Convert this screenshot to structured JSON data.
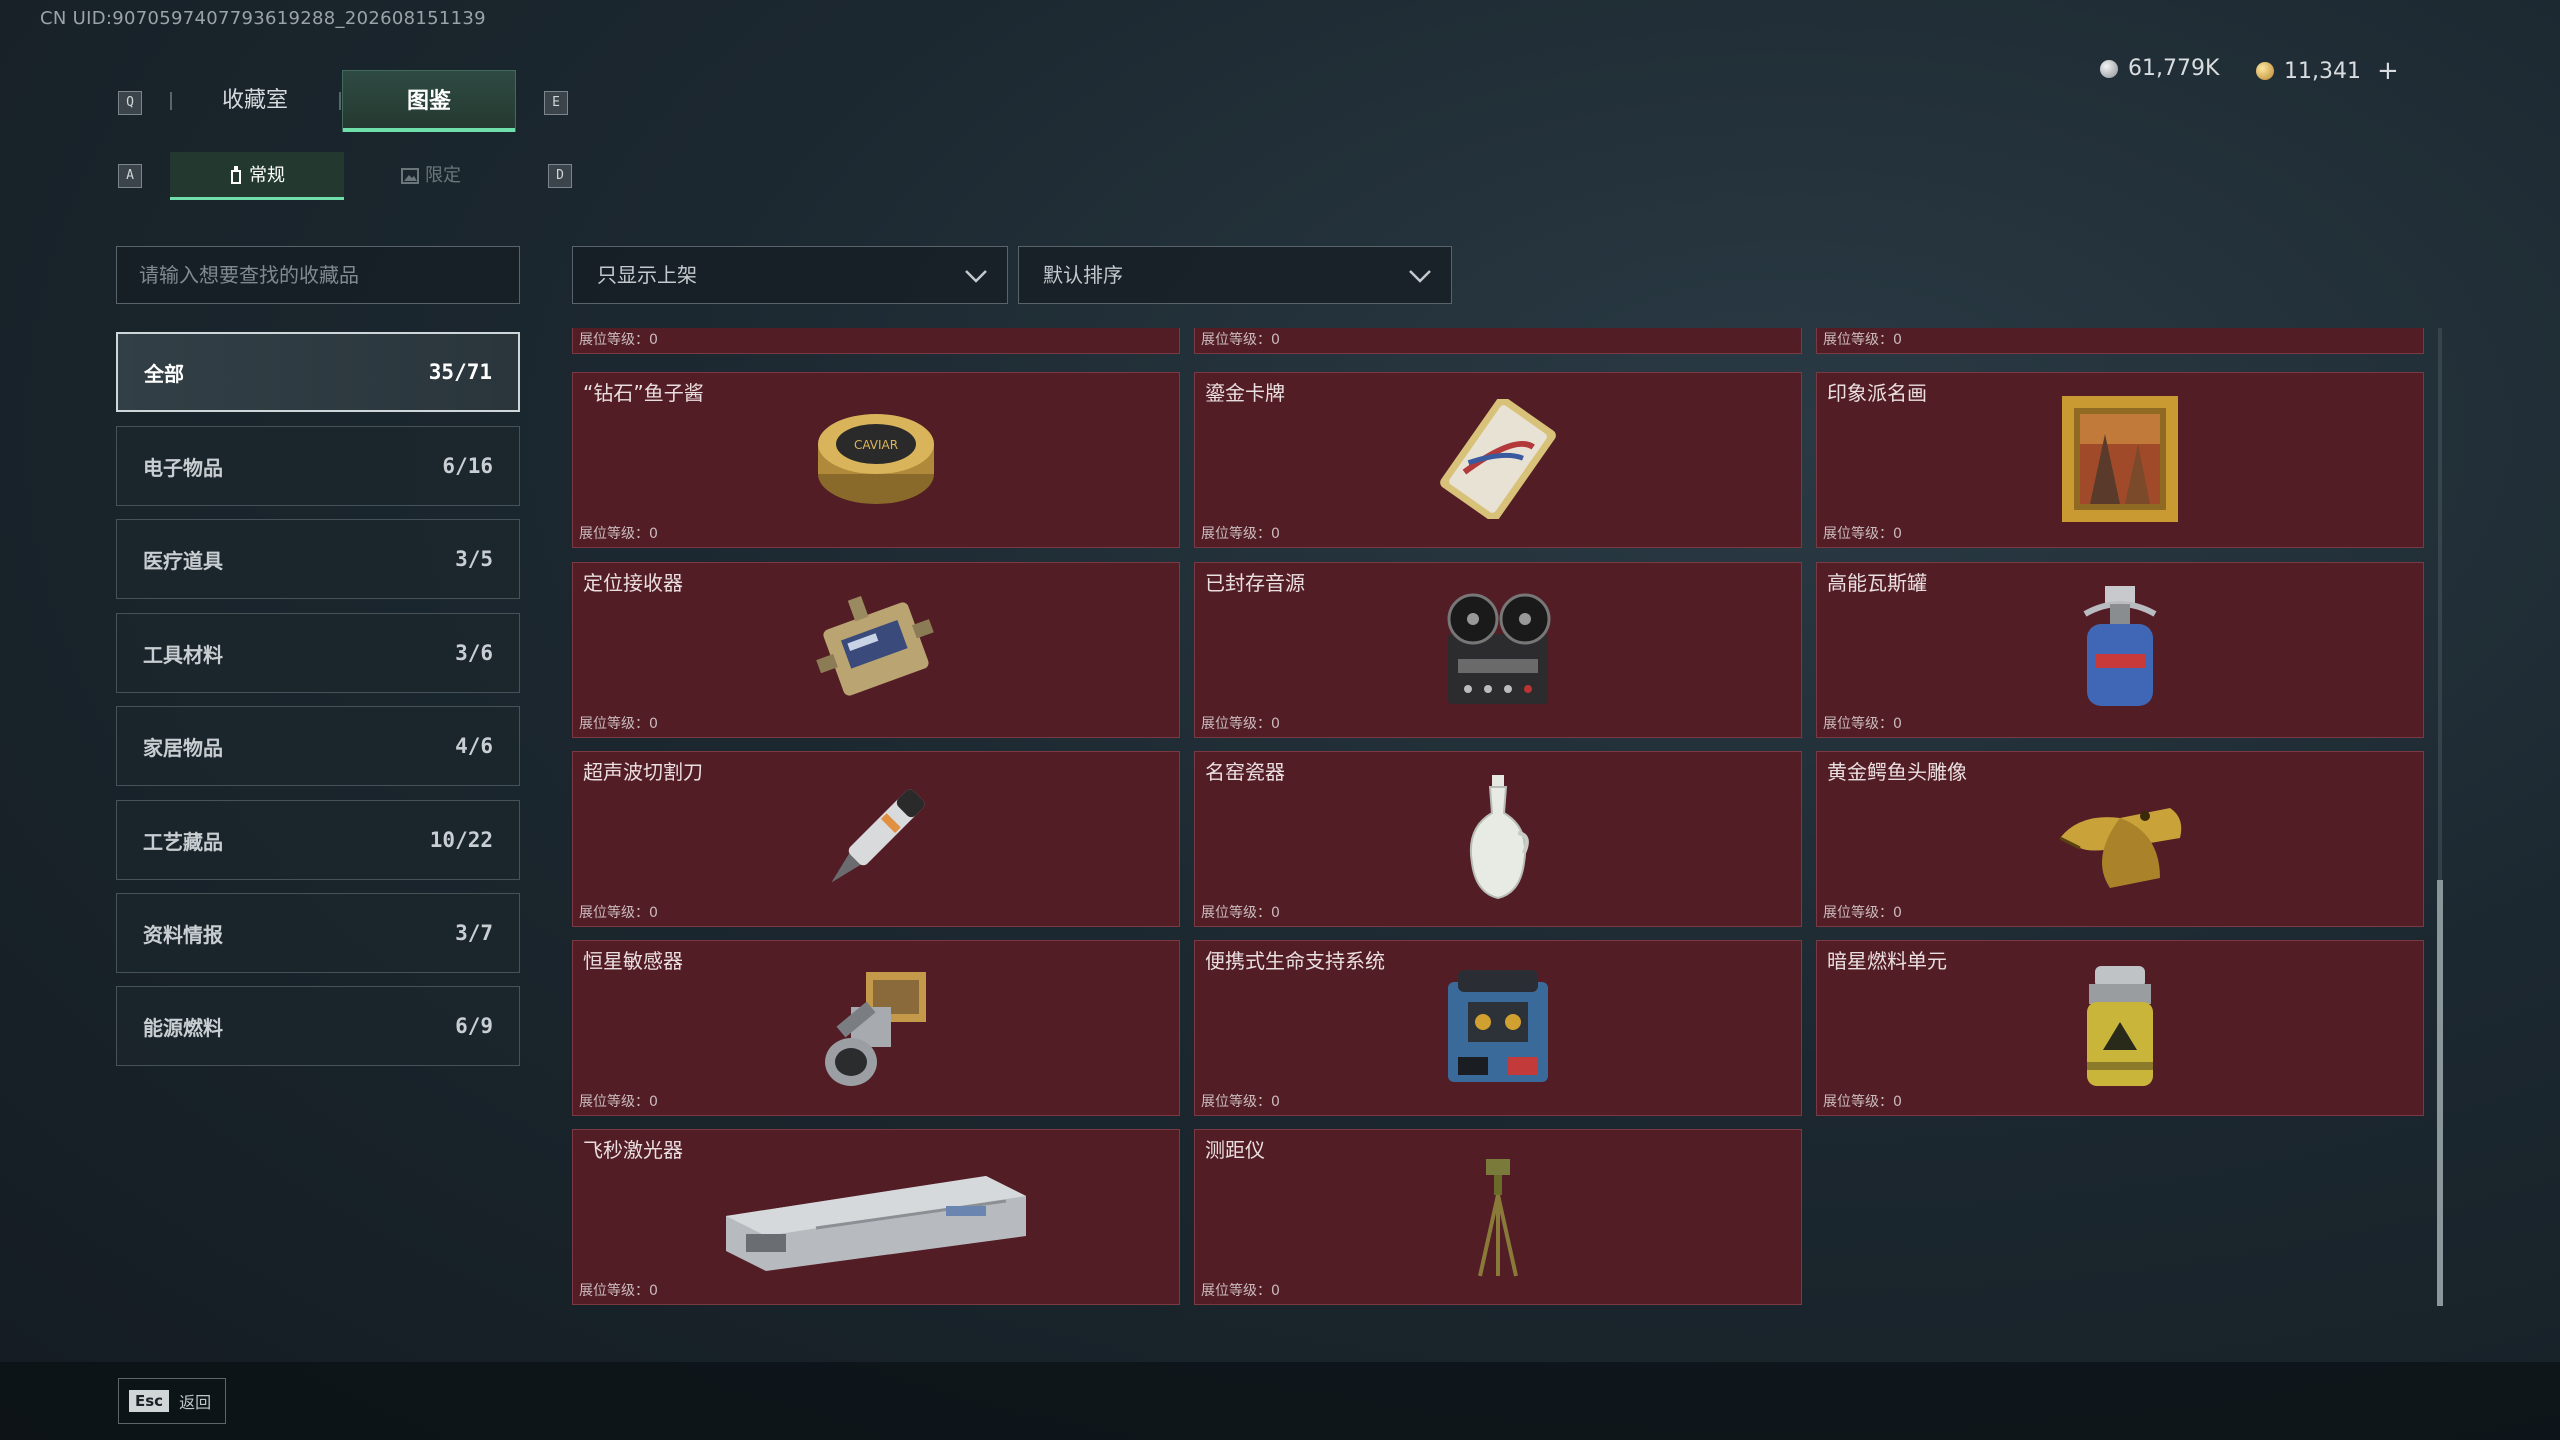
{
  "header": {
    "uid": "CN UID:9070597407793619288_202608151139",
    "currency": [
      {
        "icon": "silver-coin-icon",
        "value": "61,779K"
      },
      {
        "icon": "gold-coin-icon",
        "value": "11,341"
      }
    ],
    "add_label": "+"
  },
  "keys": {
    "q": "Q",
    "e": "E",
    "a": "A",
    "d": "D"
  },
  "tabs": [
    {
      "label": "收藏室",
      "active": false
    },
    {
      "label": "图鉴",
      "active": true
    }
  ],
  "subtabs": [
    {
      "label": "常规",
      "active": true
    },
    {
      "label": "限定",
      "active": false
    }
  ],
  "search": {
    "placeholder": "请输入想要查找的收藏品"
  },
  "filters": {
    "display": {
      "value": "只显示上架"
    },
    "sort": {
      "value": "默认排序"
    }
  },
  "categories": [
    {
      "label": "全部",
      "count": "35/71",
      "active": true
    },
    {
      "label": "电子物品",
      "count": "6/16"
    },
    {
      "label": "医疗道具",
      "count": "3/5"
    },
    {
      "label": "工具材料",
      "count": "3/6"
    },
    {
      "label": "家居物品",
      "count": "4/6"
    },
    {
      "label": "工艺藏品",
      "count": "10/22"
    },
    {
      "label": "资料情报",
      "count": "3/7"
    },
    {
      "label": "能源燃料",
      "count": "6/9"
    }
  ],
  "level_label": "展位等级：0",
  "items": [
    {
      "name": "",
      "icon": "partial-item-icon"
    },
    {
      "name": "",
      "icon": "partial-item-icon"
    },
    {
      "name": "",
      "icon": "partial-item-icon"
    },
    {
      "name": "“钻石”鱼子酱",
      "icon": "caviar-tin-icon"
    },
    {
      "name": "鎏金卡牌",
      "icon": "gilded-card-icon"
    },
    {
      "name": "印象派名画",
      "icon": "framed-painting-icon"
    },
    {
      "name": "定位接收器",
      "icon": "locator-receiver-icon"
    },
    {
      "name": "已封存音源",
      "icon": "reel-recorder-icon"
    },
    {
      "name": "高能瓦斯罐",
      "icon": "gas-canister-icon"
    },
    {
      "name": "超声波切割刀",
      "icon": "ultrasonic-cutter-icon"
    },
    {
      "name": "名窑瓷器",
      "icon": "porcelain-vase-icon"
    },
    {
      "name": "黄金鳄鱼头雕像",
      "icon": "golden-crocodile-icon"
    },
    {
      "name": "恒星敏感器",
      "icon": "star-sensor-icon"
    },
    {
      "name": "便携式生命支持系统",
      "icon": "life-support-icon"
    },
    {
      "name": "暗星燃料单元",
      "icon": "fuel-cell-icon"
    },
    {
      "name": "飞秒激光器",
      "icon": "femtosecond-laser-icon"
    },
    {
      "name": "测距仪",
      "icon": "rangefinder-tripod-icon"
    }
  ],
  "footer": {
    "esc_key": "Esc",
    "back_label": "返回"
  },
  "colors": {
    "accent": "#6fe0a9",
    "card_bg": "#531d26",
    "card_border": "#7a3a43"
  }
}
